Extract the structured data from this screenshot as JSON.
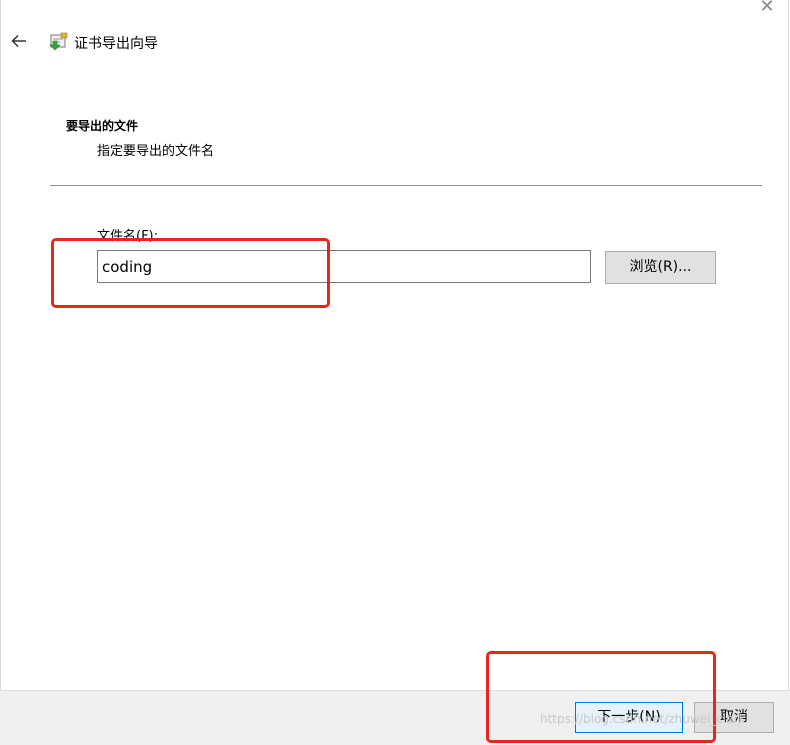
{
  "window": {
    "title": "证书导出向导",
    "close_glyph": "✕"
  },
  "section": {
    "title": "要导出的文件",
    "subtitle": "指定要导出的文件名"
  },
  "file": {
    "label": "文件名(F):",
    "value": "coding",
    "browse_label": "浏览(R)..."
  },
  "footer": {
    "next_label": "下一步(N)",
    "cancel_label": "取消"
  },
  "watermark": "https://blog.csdn.net/zhuwei_clark",
  "colors": {
    "highlight": "#e8261c",
    "primary_border": "#0078d7"
  }
}
